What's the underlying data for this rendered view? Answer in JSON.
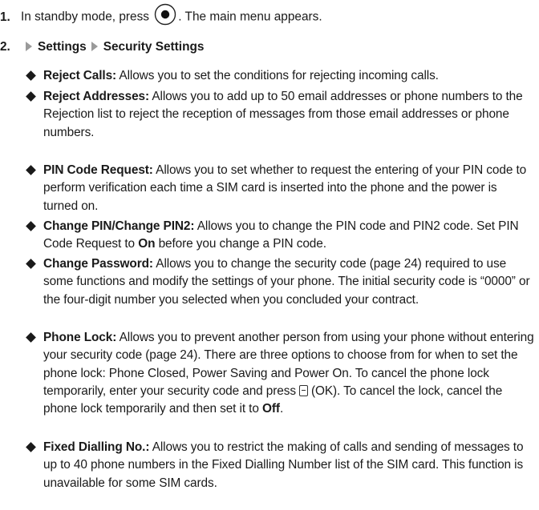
{
  "step1": {
    "number": "1.",
    "pre": "In standby mode, press",
    "key_icon": "center-select-key-icon",
    "post": ". The main menu appears."
  },
  "step2": {
    "number": "2.",
    "crumb1": "Settings",
    "crumb2": "Security Settings"
  },
  "items": [
    {
      "term": "Reject Calls:",
      "desc": "Allows you to set the conditions for rejecting incoming calls."
    },
    {
      "term": "Reject Addresses:",
      "desc": "Allows you to add up to 50 email addresses or phone numbers to the Rejection list to reject the reception of messages from those email addresses or phone numbers."
    },
    {
      "term": "PIN Code Request:",
      "desc": "Allows you to set whether to request the entering of your PIN code to perform verification each time a SIM card is inserted into the phone and the power is turned on."
    },
    {
      "term": "Change PIN/Change PIN2:",
      "desc1": "Allows you to change the PIN code and PIN2 code. Set PIN Code Request to",
      "bold": "On",
      "desc2": "before you change a PIN code."
    },
    {
      "term": "Change Password:",
      "desc": "Allows you to change the security code (page 24) required to use some functions and modify the settings of your phone. The initial security code is “0000” or the four-digit number you selected when you concluded your contract."
    },
    {
      "term": "Phone Lock:",
      "desc1": "Allows you to prevent another person from using your phone without entering your security code (page 24). There are three options to choose from for when to set the phone lock: Phone Closed, Power Saving and Power On. To cancel the phone lock temporarily, enter your security code and press",
      "key_icon": "left-softkey-icon",
      "desc2": "(OK). To cancel the lock, cancel the phone lock temporarily and then set it to",
      "bold": "Off",
      "desc3": "."
    },
    {
      "term": "Fixed Dialling No.:",
      "desc": "Allows you to restrict the making of calls and sending of messages to up to 40 phone numbers in the Fixed Dialling Number list of the SIM card. This function is unavailable for some SIM cards."
    }
  ]
}
